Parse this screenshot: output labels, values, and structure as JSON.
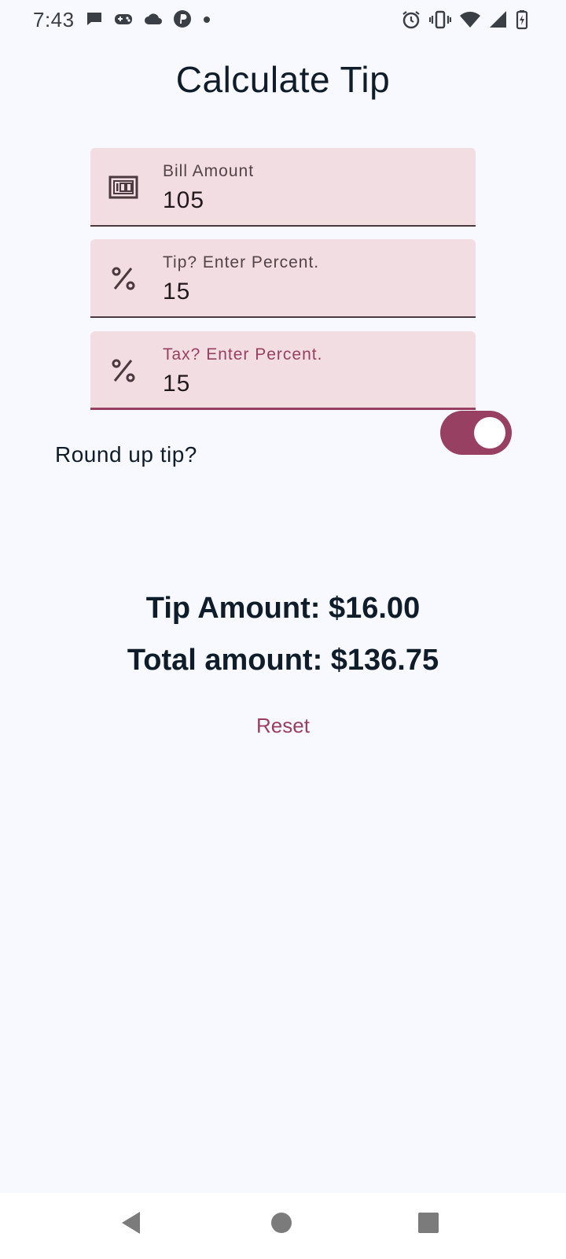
{
  "status_bar": {
    "time": "7:43",
    "left_icons": [
      "message-icon",
      "game-controller-icon",
      "cloud-icon",
      "pinterest-icon",
      "dot-icon"
    ],
    "right_icons": [
      "alarm-icon",
      "vibrate-icon",
      "wifi-icon",
      "signal-icon",
      "battery-icon"
    ]
  },
  "title": "Calculate Tip",
  "fields": {
    "bill": {
      "label": "Bill Amount",
      "value": "105",
      "icon": "money-icon"
    },
    "tip": {
      "label": "Tip? Enter Percent.",
      "value": "15",
      "icon": "percent-icon"
    },
    "tax": {
      "label": "Tax? Enter Percent.",
      "value": "15",
      "icon": "percent-icon"
    }
  },
  "round_up": {
    "label": "Round up tip?",
    "checked": true
  },
  "results": {
    "tip_amount": "Tip Amount: $16.00",
    "total_amount": "Total amount: $136.75"
  },
  "reset_label": "Reset",
  "colors": {
    "accent": "#984061",
    "field_bg": "#f2dde2",
    "background": "#f8f9ff",
    "text": "#0f1d2a"
  },
  "nav": [
    "back-icon",
    "home-icon",
    "recents-icon"
  ]
}
